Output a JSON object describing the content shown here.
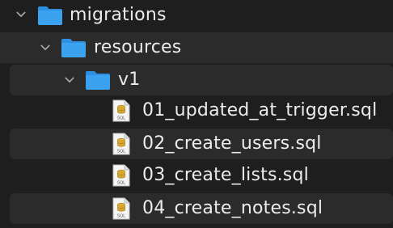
{
  "tree": {
    "folders": [
      {
        "name": "migrations",
        "expanded": true
      },
      {
        "name": "resources",
        "expanded": true
      },
      {
        "name": "v1",
        "expanded": true
      }
    ],
    "files": [
      {
        "name": "01_updated_at_trigger.sql",
        "icon": "sql-file-icon"
      },
      {
        "name": "02_create_users.sql",
        "icon": "sql-file-icon"
      },
      {
        "name": "03_create_lists.sql",
        "icon": "sql-file-icon"
      },
      {
        "name": "04_create_notes.sql",
        "icon": "sql-file-icon"
      }
    ],
    "colors": {
      "background": "#1e1e1e",
      "alt_row": "#2b2b2b",
      "folder_blue": "#3aa2ef",
      "text": "#ececec",
      "chevron": "#a8a8a8"
    },
    "file_icon_text": "SQL"
  }
}
